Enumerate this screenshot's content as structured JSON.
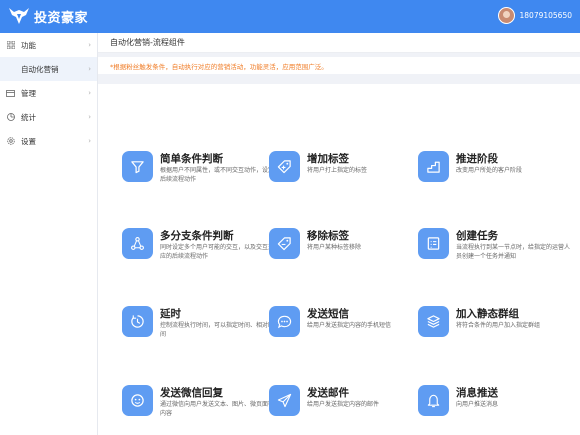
{
  "app": {
    "logo_text": "投资豪家",
    "phone": "18079105650"
  },
  "sidebar": {
    "items": [
      {
        "label": "功能",
        "icon": "grid-icon"
      },
      {
        "label": "自动化营销",
        "icon": "",
        "active": true
      },
      {
        "label": "管理",
        "icon": "card-icon"
      },
      {
        "label": "统计",
        "icon": "pie-icon"
      },
      {
        "label": "设置",
        "icon": "gear-icon"
      }
    ]
  },
  "header": {
    "title": "自动化营销-流程组件"
  },
  "notice": "*根据粉丝触发条件，自动执行对应的营销活动，功能灵活，应用范围广泛。",
  "cards": [
    {
      "title": "简单条件判断",
      "desc": "根据用户不同属性，或不同交互动作，设定后续流程动作",
      "icon": "filter-icon"
    },
    {
      "title": "增加标签",
      "desc": "将用户打上指定的标签",
      "icon": "tag-add-icon"
    },
    {
      "title": "推进阶段",
      "desc": "改变用户所处的客户阶段",
      "icon": "stairs-icon"
    },
    {
      "title": "多分支条件判断",
      "desc": "同时设定多个用户可能的交互，以及交互对应的后续流程动作",
      "icon": "branch-icon"
    },
    {
      "title": "移除标签",
      "desc": "将用户某种标签移除",
      "icon": "tag-remove-icon"
    },
    {
      "title": "创建任务",
      "desc": "当流程执行到某一节点时，给指定的运营人员创建一个任务并通知",
      "icon": "task-icon"
    },
    {
      "title": "延时",
      "desc": "控制流程执行时间，可以指定时间、相对时间",
      "icon": "timer-icon"
    },
    {
      "title": "发送短信",
      "desc": "给用户发送指定内容的手机短信",
      "icon": "sms-icon"
    },
    {
      "title": "加入静态群组",
      "desc": "将符合条件的用户加入指定群组",
      "icon": "layers-icon"
    },
    {
      "title": "发送微信回复",
      "desc": "通过微信向用户发送文本、图片、微页面等内容",
      "icon": "wechat-icon"
    },
    {
      "title": "发送邮件",
      "desc": "给用户发送指定内容的邮件",
      "icon": "send-icon"
    },
    {
      "title": "消息推送",
      "desc": "向用户推送消息",
      "icon": "bell-icon"
    }
  ],
  "colors": {
    "brand": "#3f88f0",
    "icon_bg": "#5f9cf2",
    "notice": "#f07c26"
  }
}
